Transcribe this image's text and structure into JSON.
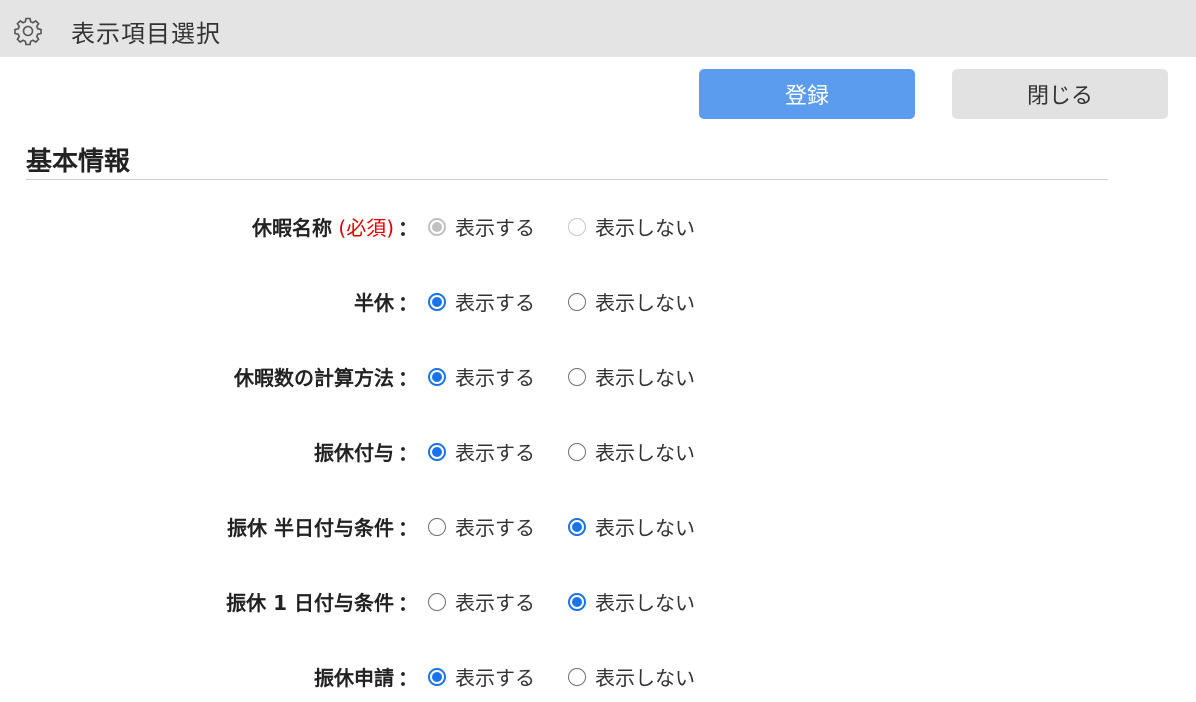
{
  "header": {
    "title": "表示項目選択",
    "icon": "gear-icon"
  },
  "buttons": {
    "register": "登録",
    "close": "閉じる"
  },
  "section": {
    "title": "基本情報"
  },
  "options": {
    "show": "表示する",
    "hide": "表示しない"
  },
  "colors": {
    "accent": "#1a73e8",
    "register_bg": "#5b9cee",
    "required": "#e00000"
  },
  "rows": [
    {
      "label": "休暇名称",
      "required_mark": "(必須)",
      "colon": "：",
      "selected": "show",
      "disabled": true
    },
    {
      "label": "半休",
      "colon": "：",
      "selected": "show",
      "disabled": false
    },
    {
      "label": "休暇数の計算方法",
      "colon": "：",
      "selected": "show",
      "disabled": false
    },
    {
      "label": "振休付与",
      "colon": "：",
      "selected": "show",
      "disabled": false
    },
    {
      "label": "振休 半日付与条件",
      "colon": "：",
      "selected": "hide",
      "disabled": false
    },
    {
      "label": "振休 1 日付与条件",
      "colon": "：",
      "selected": "hide",
      "disabled": false
    },
    {
      "label": "振休申請",
      "colon": "：",
      "selected": "show",
      "disabled": false
    }
  ]
}
